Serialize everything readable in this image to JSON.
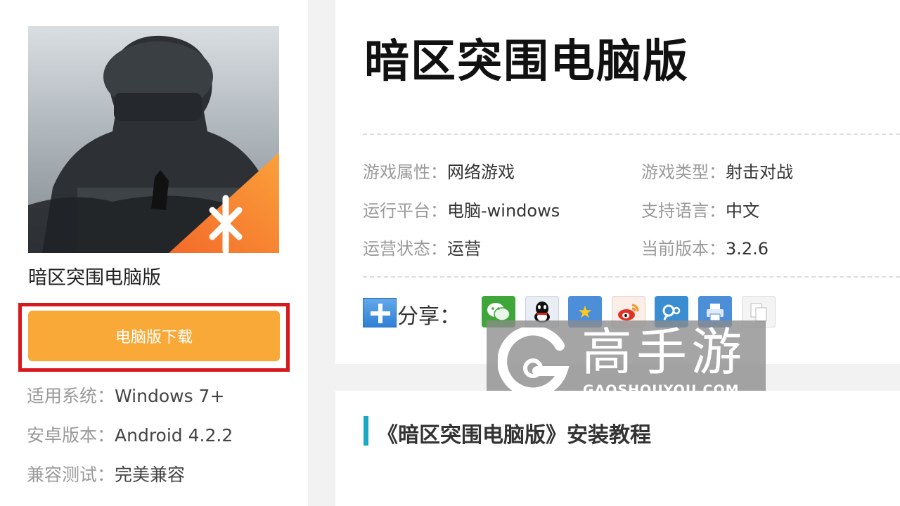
{
  "game": {
    "name": "暗区突围电脑版",
    "title": "暗区突围电脑版"
  },
  "download": {
    "label": "电脑版下载",
    "highlight_color": "#d7191f",
    "button_color": "#f9a937"
  },
  "specs": [
    {
      "key": "适用系统：",
      "value": "Windows 7+"
    },
    {
      "key": "安卓版本：",
      "value": "Android 4.2.2"
    },
    {
      "key": "兼容测试：",
      "value": "完美兼容"
    }
  ],
  "attributes": [
    {
      "key": "游戏属性：",
      "value": "网络游戏"
    },
    {
      "key": "游戏类型：",
      "value": "射击对战"
    },
    {
      "key": "运行平台：",
      "value": "电脑-windows"
    },
    {
      "key": "支持语言：",
      "value": "中文"
    },
    {
      "key": "运营状态：",
      "value": "运营"
    },
    {
      "key": "当前版本：",
      "value": "3.2.6"
    }
  ],
  "share": {
    "label": "分享：",
    "icons": [
      "wechat-icon",
      "qq-icon",
      "qzone-icon",
      "weibo-icon",
      "tencent-weibo-icon",
      "print-icon",
      "copy-icon"
    ]
  },
  "watermark": {
    "text_cn": "高手游",
    "text_en": "GAOSHOUYOU.COM"
  },
  "section": {
    "title": "《暗区突围电脑版》安装教程",
    "accent_color": "#1aa8c4"
  }
}
